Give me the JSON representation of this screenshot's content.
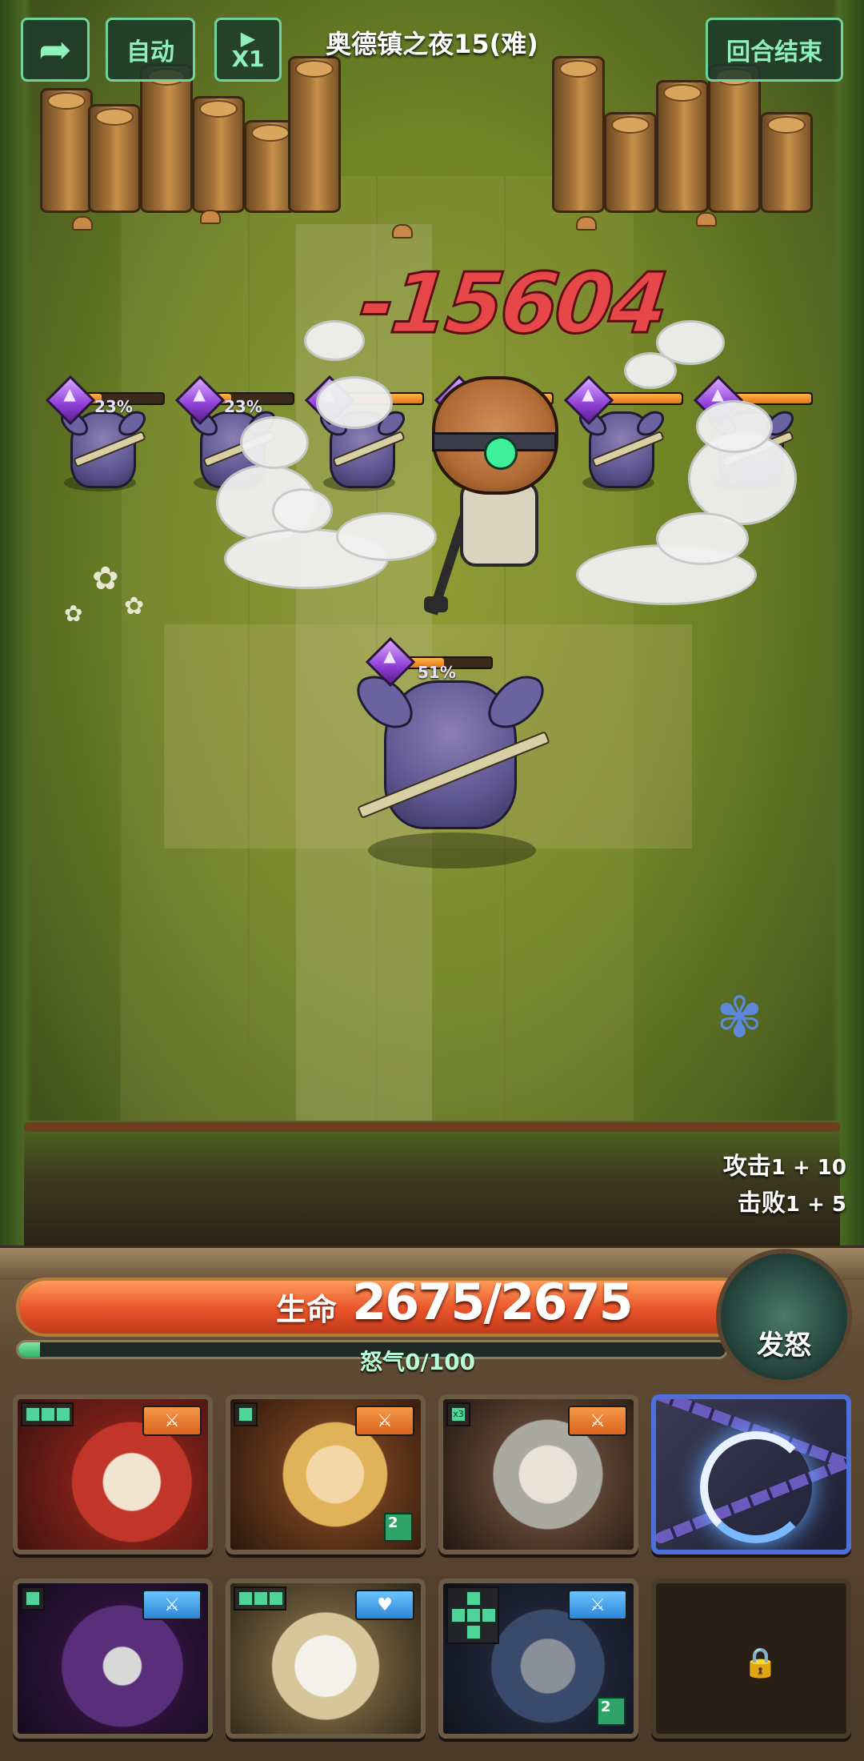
{
  "top_bar": {
    "back_icon": "back-arrow-icon",
    "auto_label": "自动",
    "speed_label": "X1",
    "speed_icon": "play-icon",
    "stage_title": "奥德镇之夜15(难)",
    "end_turn_label": "回合结束"
  },
  "battle": {
    "damage_text": "-15604",
    "enemies": [
      {
        "hp_percent": "23%",
        "hp_fraction": 0.23
      },
      {
        "hp_percent": "23%",
        "hp_fraction": 0.23
      },
      {
        "hp_percent": "",
        "hp_fraction": 1.0
      },
      {
        "hp_percent": "",
        "hp_fraction": 1.0
      },
      {
        "hp_percent": "",
        "hp_fraction": 1.0
      },
      {
        "hp_percent": "",
        "hp_fraction": 1.0
      }
    ],
    "front_enemy": {
      "hp_percent": "51%",
      "hp_fraction": 0.51
    },
    "stats": {
      "attack_label": "攻击",
      "attack_value": "1 + 10",
      "defeat_label": "击败",
      "defeat_value": "1 + 5"
    }
  },
  "hud": {
    "life_label": "生命",
    "life_value": "2675/2675",
    "life_fraction": 1.0,
    "rage_label": "怒气0/100",
    "rage_fraction": 0.03,
    "rage_button_label": "发怒"
  },
  "cards": [
    {
      "name": "hero-card-1",
      "tag_color": "orange",
      "tag_icon": "sword-icon",
      "pattern": [
        1,
        1,
        1
      ]
    },
    {
      "name": "hero-card-2",
      "tag_color": "orange",
      "tag_icon": "sword-icon",
      "pattern": [
        1
      ],
      "level": "2"
    },
    {
      "name": "hero-card-3",
      "tag_color": "orange",
      "tag_icon": "sword-icon",
      "pattern_text": "x3"
    },
    {
      "name": "chain-skill-card"
    },
    {
      "name": "hero-card-5",
      "tag_color": "blue",
      "tag_icon": "sword-icon",
      "pattern": [
        1
      ]
    },
    {
      "name": "hero-card-6",
      "tag_color": "blue",
      "tag_icon": "heart-icon",
      "pattern": [
        1,
        1,
        1
      ]
    },
    {
      "name": "hero-card-7",
      "tag_color": "blue",
      "tag_icon": "sword-icon",
      "pattern": "cross",
      "level": "2"
    },
    {
      "name": "locked-card",
      "icon": "lock-icon"
    }
  ],
  "colors": {
    "accent_green": "#6fd39a",
    "damage_red": "#e8474a",
    "life_orange": "#e8532a",
    "rage_green": "#2fb46a"
  }
}
